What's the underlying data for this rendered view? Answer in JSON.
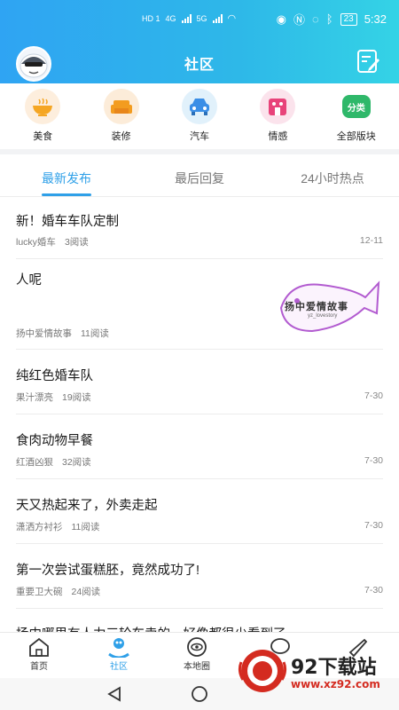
{
  "status": {
    "left_tags": [
      "HD 1",
      "4G",
      "5G"
    ],
    "battery": "23",
    "time": "5:32"
  },
  "header": {
    "title": "社区"
  },
  "categories": [
    {
      "label": "美食",
      "icon": "bowl-icon",
      "color": "#f5a623",
      "bg": "#fdeedd"
    },
    {
      "label": "装修",
      "icon": "sofa-icon",
      "color": "#f39c1f",
      "bg": "#fcecd9"
    },
    {
      "label": "汽车",
      "icon": "car-icon",
      "color": "#3a8ee6",
      "bg": "#e1f1fb"
    },
    {
      "label": "情感",
      "icon": "face-icon",
      "color": "#e8437a",
      "bg": "#fbe3ec"
    },
    {
      "label": "全部版块",
      "icon": "category-icon",
      "badge": "分类",
      "color": "#2fb86a",
      "bg": "#ffffff"
    }
  ],
  "tabs": [
    {
      "label": "最新发布",
      "active": true
    },
    {
      "label": "最后回复",
      "active": false
    },
    {
      "label": "24小时热点",
      "active": false
    }
  ],
  "posts": [
    {
      "title": "新！婚车车队定制",
      "author": "lucky婚车",
      "reads": "3阅读",
      "date": "12-11"
    },
    {
      "title": "人呢",
      "author": "扬中爱情故事",
      "reads": "11阅读",
      "date": "",
      "image_text": "扬中爱情故事",
      "image_subtext": "yz_lovestory"
    },
    {
      "title": "纯红色婚车队",
      "author": "果汁漂亮",
      "reads": "19阅读",
      "date": "7-30"
    },
    {
      "title": "食肉动物早餐",
      "author": "红酒凶狠",
      "reads": "32阅读",
      "date": "7-30"
    },
    {
      "title": "天又热起来了，外卖走起",
      "author": "潇洒方衬衫",
      "reads": "11阅读",
      "date": "7-30"
    },
    {
      "title": "第一次尝试蛋糕胚，竟然成功了!",
      "author": "重要卫大碗",
      "reads": "24阅读",
      "date": "7-30"
    },
    {
      "title": "扬中哪里有人力三轮车卖的，好像都很少看到了",
      "author": "",
      "reads": "",
      "date": ""
    }
  ],
  "bottom_nav": [
    {
      "label": "首页",
      "icon": "home-icon",
      "active": false
    },
    {
      "label": "社区",
      "icon": "community-icon",
      "active": true
    },
    {
      "label": "本地圈",
      "icon": "eye-icon",
      "active": false
    }
  ],
  "watermark": {
    "text": "92下载站",
    "url": "www.xz92.com"
  }
}
